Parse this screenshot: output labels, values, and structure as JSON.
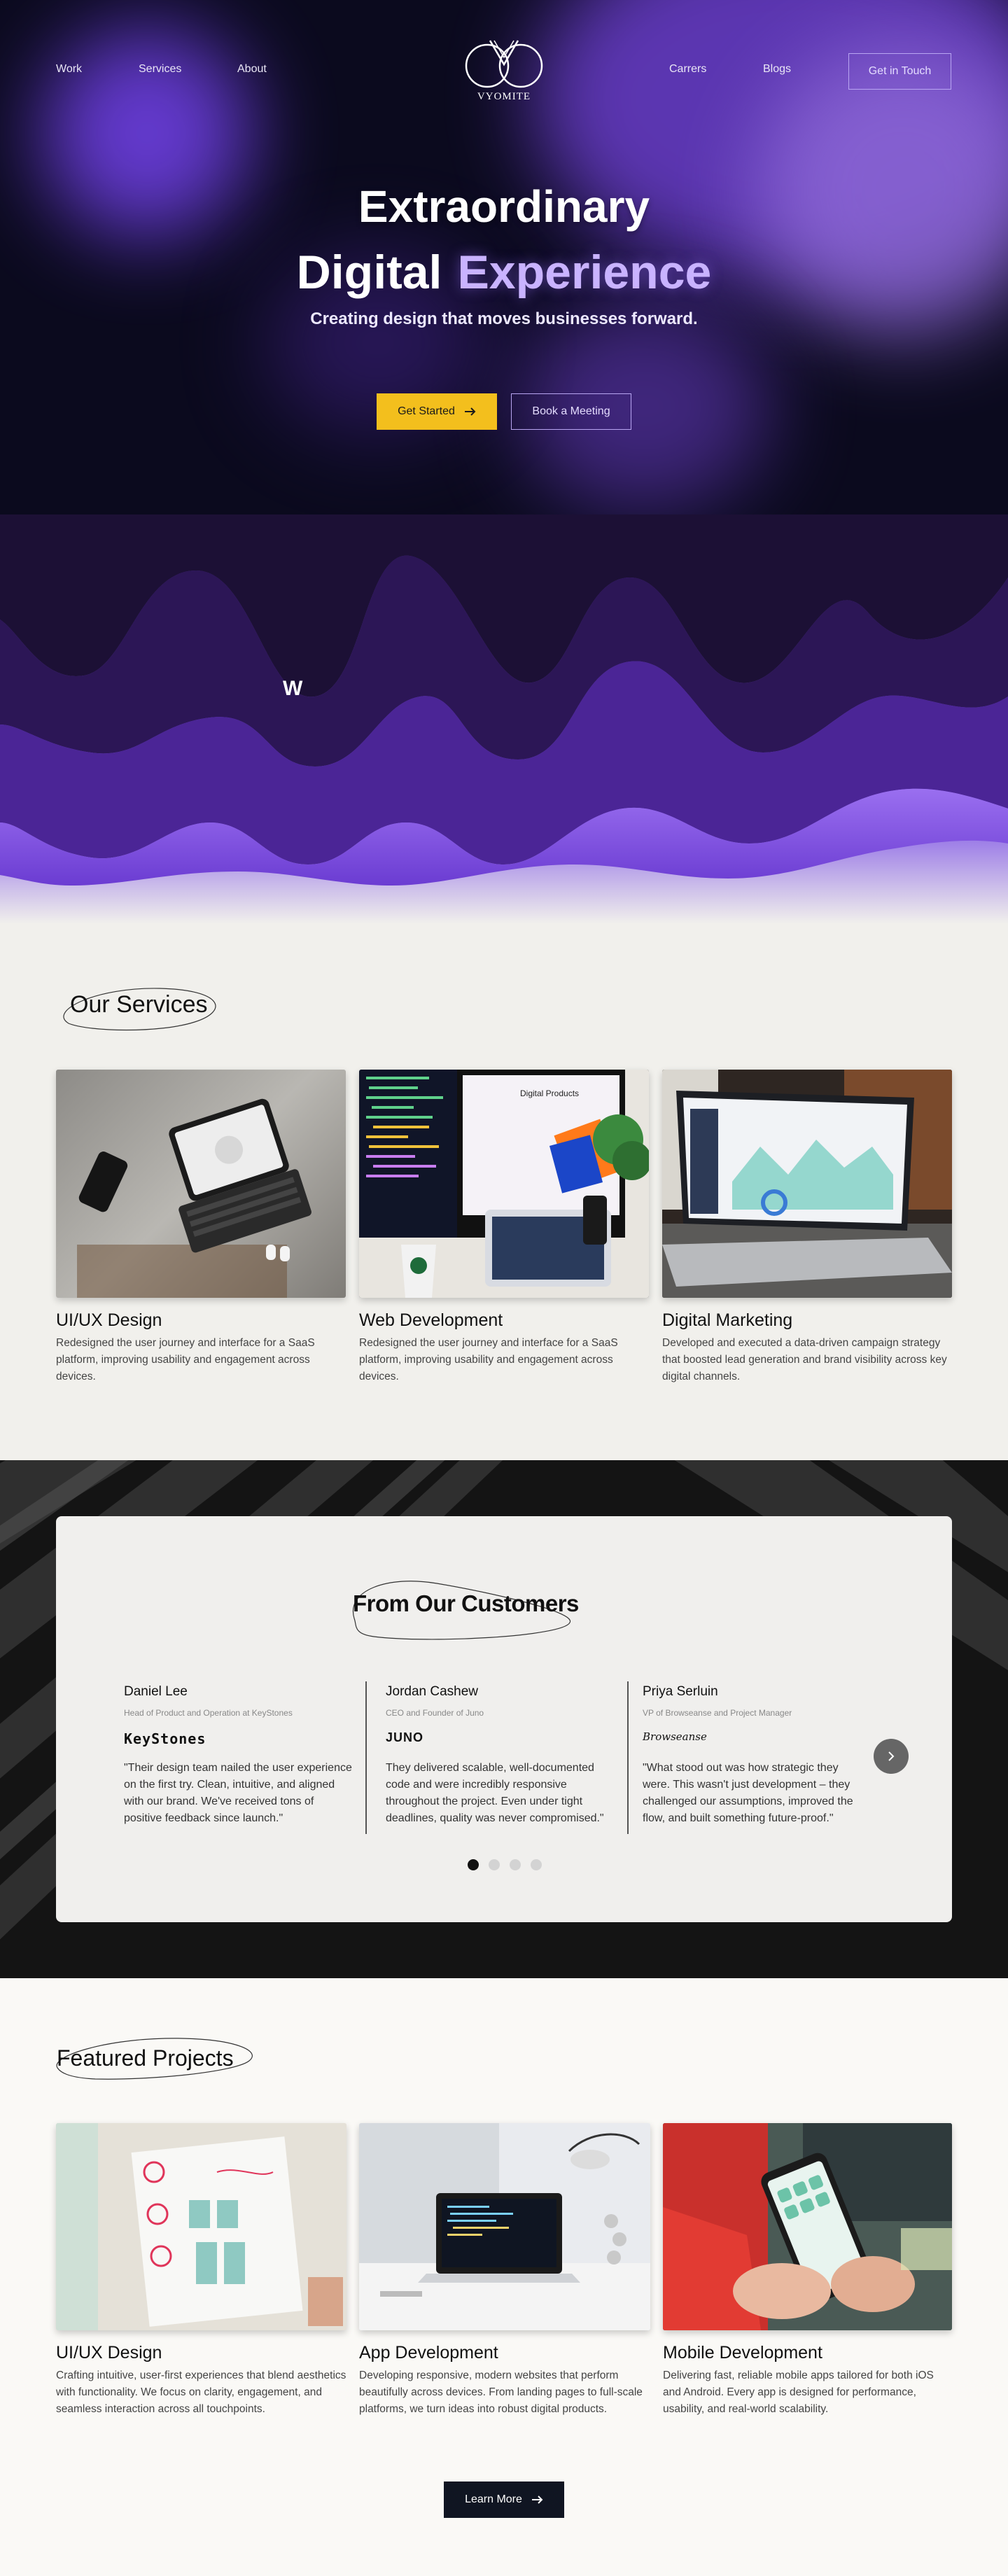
{
  "nav": {
    "left_links": [
      "Work",
      "Services",
      "About"
    ],
    "right_links": [
      "Carrers",
      "Blogs"
    ],
    "cta": "Get in Touch",
    "logo_text": "VYOMITE"
  },
  "hero": {
    "title_line1": "Extraordinary",
    "title_line2_a": "Digital",
    "title_line2_b": "Experience",
    "subtitle": "Creating design that moves businesses forward.",
    "primary_cta": "Get Started",
    "secondary_cta": "Book a Meeting"
  },
  "waves": {
    "letter": "W"
  },
  "services": {
    "title": "Our Services",
    "items": [
      {
        "title": "UI/UX Design",
        "description": "Redesigned the user journey and interface for a SaaS platform, improving usability and engagement across devices."
      },
      {
        "title": "Web Development",
        "description": "Redesigned the user journey and interface for a SaaS platform, improving usability and engagement across devices."
      },
      {
        "title": "Digital Marketing",
        "description": "Developed and executed a data-driven campaign strategy that boosted lead generation and brand visibility across key digital channels."
      }
    ]
  },
  "testimonials": {
    "title": "From Our Customers",
    "items": [
      {
        "name": "Daniel Lee",
        "role": "Head of Product and Operation at KeyStones",
        "logo": "KeyStones",
        "quote": "\"Their design team nailed the user experience on the first try. Clean, intuitive, and aligned with our brand. We've received tons of positive feedback since launch.\""
      },
      {
        "name": "Jordan Cashew",
        "role": "CEO and Founder of Juno",
        "logo": "JUNO",
        "quote": "They delivered scalable, well-documented code and were incredibly responsive throughout the project. Even under tight deadlines, quality was never compromised.\""
      },
      {
        "name": "Priya Serluin",
        "role": "VP of Browseanse and Project Manager",
        "logo": "Browseanse",
        "quote": "\"What stood out was how strategic they were. This wasn't just development – they challenged our assumptions, improved the flow, and built something future-proof.\""
      }
    ],
    "active_dot": 0,
    "dot_count": 4
  },
  "projects": {
    "title": "Featured Projects",
    "items": [
      {
        "title": "UI/UX Design",
        "description": "Crafting intuitive, user-first experiences that blend aesthetics with functionality. We focus on clarity, engagement, and seamless interaction across all touchpoints."
      },
      {
        "title": "App Development",
        "description": "Developing responsive, modern websites that perform beautifully across devices. From landing pages to full-scale platforms, we turn ideas into robust digital products."
      },
      {
        "title": "Mobile Development",
        "description": "Delivering fast, reliable mobile apps tailored for both iOS and Android. Every app is designed for performance, usability, and real-world scalability."
      }
    ],
    "cta": "Learn More"
  },
  "colors": {
    "accent_purple": "#c9b3ff",
    "cta_yellow": "#f3bf1d",
    "dark_navy": "#101522"
  },
  "icons": [
    "logo-mark",
    "arrow-right-icon",
    "chevron-right-icon"
  ]
}
